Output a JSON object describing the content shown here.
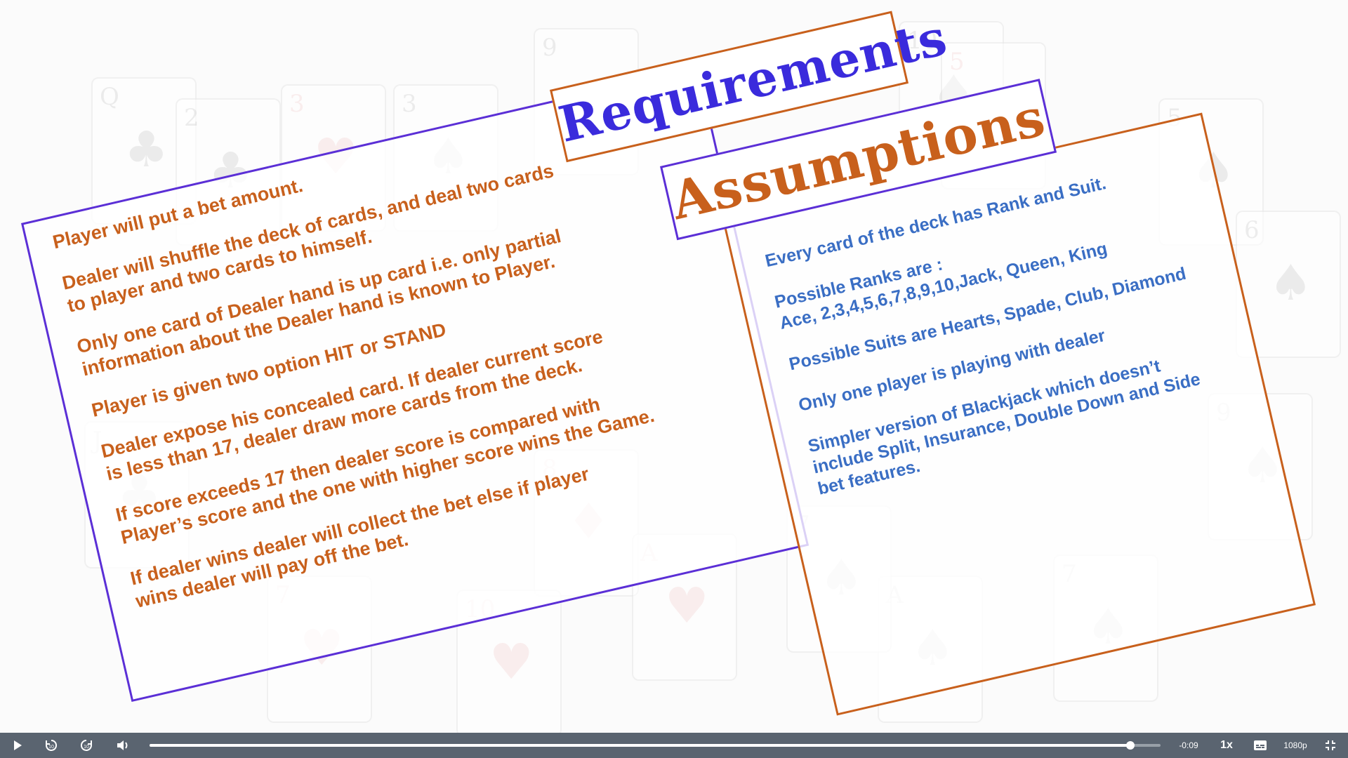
{
  "requirements": {
    "title": "Requirements",
    "items": [
      [
        "Player will put a bet amount."
      ],
      [
        "Dealer will shuffle the deck of cards, and deal two cards",
        "to player and two cards to himself."
      ],
      [
        "Only one card of Dealer hand is up card i.e. only partial",
        "information about the Dealer hand is known to Player."
      ],
      [
        "Player is given two option HIT or STAND"
      ],
      [
        "Dealer expose his concealed card. If dealer current score",
        "is less than 17, dealer draw more cards from the deck."
      ],
      [
        "If score exceeds 17 then dealer score is compared with",
        "Player’s score and the one with higher score wins the Game."
      ],
      [
        "If dealer wins dealer will collect the bet else if player",
        "wins dealer will pay off the bet."
      ]
    ]
  },
  "assumptions": {
    "title": "Assumptions",
    "items": [
      [
        "Every card of the deck has Rank and Suit."
      ],
      [
        "Possible Ranks are :",
        "Ace, 2,3,4,5,6,7,8,9,10,Jack, Queen, King"
      ],
      [
        "Possible Suits  are Hearts, Spade, Club, Diamond"
      ],
      [
        "Only one player is playing with dealer"
      ],
      [
        "Simpler version of Blackjack which doesn’t",
        "include Split,  Insurance, Double Down and Side",
        "bet features."
      ]
    ]
  },
  "player": {
    "play_icon": "play-icon",
    "rewind_icon": "rewind-10-icon",
    "forward_icon": "forward-10-icon",
    "volume_icon": "volume-icon",
    "time_remaining": "-0:09",
    "speed": "1x",
    "captions_icon": "captions-icon",
    "quality": "1080p",
    "fullscreen_icon": "exit-fullscreen-icon",
    "progress": 0.97
  },
  "colors": {
    "requirements_border": "#5b2fd6",
    "requirements_text": "#c8601c",
    "assumptions_border": "#c8601c",
    "assumptions_text": "#3a6ec4",
    "requirements_title": "#3a2bdc",
    "assumptions_title": "#c8601c",
    "control_bar": "#5a6470"
  }
}
